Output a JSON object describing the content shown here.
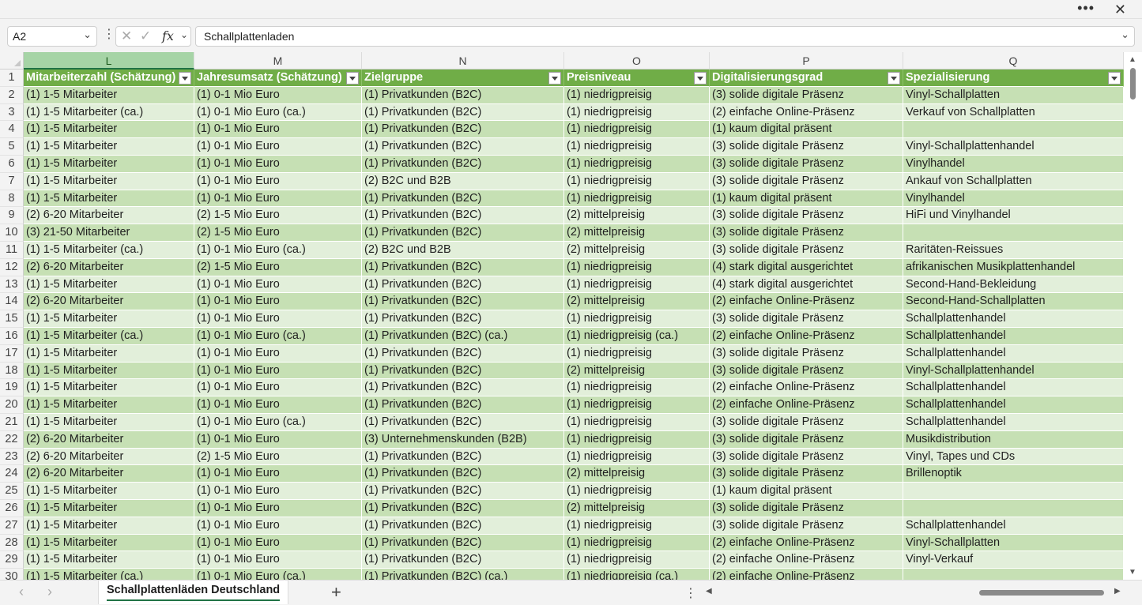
{
  "window": {
    "more_label": "•••",
    "close_label": "✕"
  },
  "formula_bar": {
    "name_box": "A2",
    "formula": "Schallplattenladen",
    "icons": [
      "cancel-icon",
      "enter-icon",
      "function-icon"
    ]
  },
  "grid": {
    "columns": [
      {
        "letter": "L",
        "header": "Mitarbeiterzahl (Schätzung)",
        "selected": true
      },
      {
        "letter": "M",
        "header": "Jahresumsatz (Schätzung)"
      },
      {
        "letter": "N",
        "header": "Zielgruppe"
      },
      {
        "letter": "O",
        "header": "Preisniveau"
      },
      {
        "letter": "P",
        "header": "Digitalisierungsgrad"
      },
      {
        "letter": "Q",
        "header": "Spezialisierung"
      }
    ],
    "header_row_number": "1",
    "rows": [
      {
        "n": "2",
        "cells": [
          "(1) 1-5 Mitarbeiter",
          "(1) 0-1 Mio Euro",
          "(1) Privatkunden (B2C)",
          "(1) niedrigpreisig",
          "(3) solide digitale Präsenz",
          "Vinyl-Schallplatten"
        ]
      },
      {
        "n": "3",
        "cells": [
          "(1) 1-5 Mitarbeiter (ca.)",
          "(1) 0-1 Mio Euro (ca.)",
          "(1) Privatkunden (B2C)",
          "(1) niedrigpreisig",
          "(2) einfache Online-Präsenz",
          "Verkauf von Schallplatten"
        ]
      },
      {
        "n": "4",
        "cells": [
          "(1) 1-5 Mitarbeiter",
          "(1) 0-1 Mio Euro",
          "(1) Privatkunden (B2C)",
          "(1) niedrigpreisig",
          "(1) kaum digital präsent",
          ""
        ]
      },
      {
        "n": "5",
        "cells": [
          "(1) 1-5 Mitarbeiter",
          "(1) 0-1 Mio Euro",
          "(1) Privatkunden (B2C)",
          "(1) niedrigpreisig",
          "(3) solide digitale Präsenz",
          "Vinyl-Schallplattenhandel"
        ]
      },
      {
        "n": "6",
        "cells": [
          "(1) 1-5 Mitarbeiter",
          "(1) 0-1 Mio Euro",
          "(1) Privatkunden (B2C)",
          "(1) niedrigpreisig",
          "(3) solide digitale Präsenz",
          "Vinylhandel"
        ]
      },
      {
        "n": "7",
        "cells": [
          "(1) 1-5 Mitarbeiter",
          "(1) 0-1 Mio Euro",
          "(2) B2C und B2B",
          "(1) niedrigpreisig",
          "(3) solide digitale Präsenz",
          "Ankauf von Schallplatten"
        ]
      },
      {
        "n": "8",
        "cells": [
          "(1) 1-5 Mitarbeiter",
          "(1) 0-1 Mio Euro",
          "(1) Privatkunden (B2C)",
          "(1) niedrigpreisig",
          "(1) kaum digital präsent",
          "Vinylhandel"
        ]
      },
      {
        "n": "9",
        "cells": [
          "(2) 6-20 Mitarbeiter",
          "(2) 1-5 Mio Euro",
          "(1) Privatkunden (B2C)",
          "(2) mittelpreisig",
          "(3) solide digitale Präsenz",
          "HiFi und Vinylhandel"
        ]
      },
      {
        "n": "10",
        "cells": [
          "(3) 21-50 Mitarbeiter",
          "(2) 1-5 Mio Euro",
          "(1) Privatkunden (B2C)",
          "(2) mittelpreisig",
          "(3) solide digitale Präsenz",
          ""
        ]
      },
      {
        "n": "11",
        "cells": [
          "(1) 1-5 Mitarbeiter (ca.)",
          "(1) 0-1 Mio Euro (ca.)",
          "(2) B2C und B2B",
          "(2) mittelpreisig",
          "(3) solide digitale Präsenz",
          "Raritäten-Reissues"
        ]
      },
      {
        "n": "12",
        "cells": [
          "(2) 6-20 Mitarbeiter",
          "(2) 1-5 Mio Euro",
          "(1) Privatkunden (B2C)",
          "(1) niedrigpreisig",
          "(4) stark digital ausgerichtet",
          "afrikanischen Musikplattenhandel"
        ]
      },
      {
        "n": "13",
        "cells": [
          "(1) 1-5 Mitarbeiter",
          "(1) 0-1 Mio Euro",
          "(1) Privatkunden (B2C)",
          "(1) niedrigpreisig",
          "(4) stark digital ausgerichtet",
          "Second-Hand-Bekleidung"
        ]
      },
      {
        "n": "14",
        "cells": [
          "(2) 6-20 Mitarbeiter",
          "(1) 0-1 Mio Euro",
          "(1) Privatkunden (B2C)",
          "(2) mittelpreisig",
          "(2) einfache Online-Präsenz",
          "Second-Hand-Schallplatten"
        ]
      },
      {
        "n": "15",
        "cells": [
          "(1) 1-5 Mitarbeiter",
          "(1) 0-1 Mio Euro",
          "(1) Privatkunden (B2C)",
          "(1) niedrigpreisig",
          "(3) solide digitale Präsenz",
          "Schallplattenhandel"
        ]
      },
      {
        "n": "16",
        "cells": [
          "(1) 1-5 Mitarbeiter (ca.)",
          "(1) 0-1 Mio Euro (ca.)",
          "(1) Privatkunden (B2C) (ca.)",
          "(1) niedrigpreisig (ca.)",
          "(2) einfache Online-Präsenz",
          "Schallplattenhandel"
        ]
      },
      {
        "n": "17",
        "cells": [
          "(1) 1-5 Mitarbeiter",
          "(1) 0-1 Mio Euro",
          "(1) Privatkunden (B2C)",
          "(1) niedrigpreisig",
          "(3) solide digitale Präsenz",
          "Schallplattenhandel"
        ]
      },
      {
        "n": "18",
        "cells": [
          "(1) 1-5 Mitarbeiter",
          "(1) 0-1 Mio Euro",
          "(1) Privatkunden (B2C)",
          "(2) mittelpreisig",
          "(3) solide digitale Präsenz",
          "Vinyl-Schallplattenhandel"
        ]
      },
      {
        "n": "19",
        "cells": [
          "(1) 1-5 Mitarbeiter",
          "(1) 0-1 Mio Euro",
          "(1) Privatkunden (B2C)",
          "(1) niedrigpreisig",
          "(2) einfache Online-Präsenz",
          "Schallplattenhandel"
        ]
      },
      {
        "n": "20",
        "cells": [
          "(1) 1-5 Mitarbeiter",
          "(1) 0-1 Mio Euro",
          "(1) Privatkunden (B2C)",
          "(1) niedrigpreisig",
          "(2) einfache Online-Präsenz",
          "Schallplattenhandel"
        ]
      },
      {
        "n": "21",
        "cells": [
          "(1) 1-5 Mitarbeiter",
          "(1) 0-1 Mio Euro (ca.)",
          "(1) Privatkunden (B2C)",
          "(1) niedrigpreisig",
          "(3) solide digitale Präsenz",
          "Schallplattenhandel"
        ]
      },
      {
        "n": "22",
        "cells": [
          "(2) 6-20 Mitarbeiter",
          "(1) 0-1 Mio Euro",
          "(3) Unternehmenskunden (B2B)",
          "(1) niedrigpreisig",
          "(3) solide digitale Präsenz",
          "Musikdistribution"
        ]
      },
      {
        "n": "23",
        "cells": [
          "(2) 6-20 Mitarbeiter",
          "(2) 1-5 Mio Euro",
          "(1) Privatkunden (B2C)",
          "(1) niedrigpreisig",
          "(3) solide digitale Präsenz",
          "Vinyl, Tapes und CDs"
        ]
      },
      {
        "n": "24",
        "cells": [
          "(2) 6-20 Mitarbeiter",
          "(1) 0-1 Mio Euro",
          "(1) Privatkunden (B2C)",
          "(2) mittelpreisig",
          "(3) solide digitale Präsenz",
          "Brillenoptik"
        ]
      },
      {
        "n": "25",
        "cells": [
          "(1) 1-5 Mitarbeiter",
          "(1) 0-1 Mio Euro",
          "(1) Privatkunden (B2C)",
          "(1) niedrigpreisig",
          "(1) kaum digital präsent",
          ""
        ]
      },
      {
        "n": "26",
        "cells": [
          "(1) 1-5 Mitarbeiter",
          "(1) 0-1 Mio Euro",
          "(1) Privatkunden (B2C)",
          "(2) mittelpreisig",
          "(3) solide digitale Präsenz",
          ""
        ]
      },
      {
        "n": "27",
        "cells": [
          "(1) 1-5 Mitarbeiter",
          "(1) 0-1 Mio Euro",
          "(1) Privatkunden (B2C)",
          "(1) niedrigpreisig",
          "(3) solide digitale Präsenz",
          "Schallplattenhandel"
        ]
      },
      {
        "n": "28",
        "cells": [
          "(1) 1-5 Mitarbeiter",
          "(1) 0-1 Mio Euro",
          "(1) Privatkunden (B2C)",
          "(1) niedrigpreisig",
          "(2) einfache Online-Präsenz",
          "Vinyl-Schallplatten"
        ]
      },
      {
        "n": "29",
        "cells": [
          "(1) 1-5 Mitarbeiter",
          "(1) 0-1 Mio Euro",
          "(1) Privatkunden (B2C)",
          "(1) niedrigpreisig",
          "(2) einfache Online-Präsenz",
          "Vinyl-Verkauf"
        ]
      },
      {
        "n": "30",
        "cells": [
          "(1) 1-5 Mitarbeiter (ca.)",
          "(1) 0-1 Mio Euro (ca.)",
          "(1) Privatkunden (B2C) (ca.)",
          "(1) niedrigpreisig (ca.)",
          "(2) einfache Online-Präsenz",
          ""
        ]
      }
    ]
  },
  "sheet_tabs": {
    "active": "Schallplattenläden Deutschland",
    "add_label": "+"
  },
  "colors": {
    "header_green": "#70ad47",
    "band_dark": "#c6e0b4",
    "band_light": "#e2efda",
    "accent": "#217346"
  }
}
